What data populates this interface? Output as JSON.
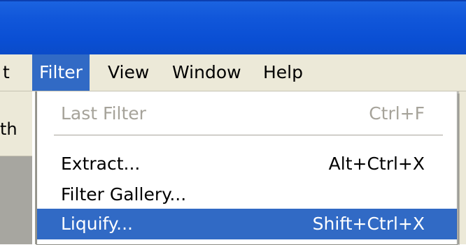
{
  "menubar": {
    "items": [
      {
        "label": "t"
      },
      {
        "label": "Filter"
      },
      {
        "label": "View"
      },
      {
        "label": "Window"
      },
      {
        "label": "Help"
      }
    ]
  },
  "options_bar": {
    "partial_text": "th"
  },
  "filter_menu": {
    "items": [
      {
        "label": "Last Filter",
        "shortcut": "Ctrl+F",
        "state": "disabled"
      },
      {
        "label": "Extract...",
        "shortcut": "Alt+Ctrl+X",
        "state": "normal"
      },
      {
        "label": "Filter Gallery...",
        "shortcut": "",
        "state": "normal"
      },
      {
        "label": "Liquify...",
        "shortcut": "Shift+Ctrl+X",
        "state": "highlighted"
      }
    ]
  },
  "colors": {
    "title_bar": "#0a4fd4",
    "menu_bg": "#ece9d8",
    "highlight": "#316ac5",
    "disabled_text": "#a6a39a"
  }
}
